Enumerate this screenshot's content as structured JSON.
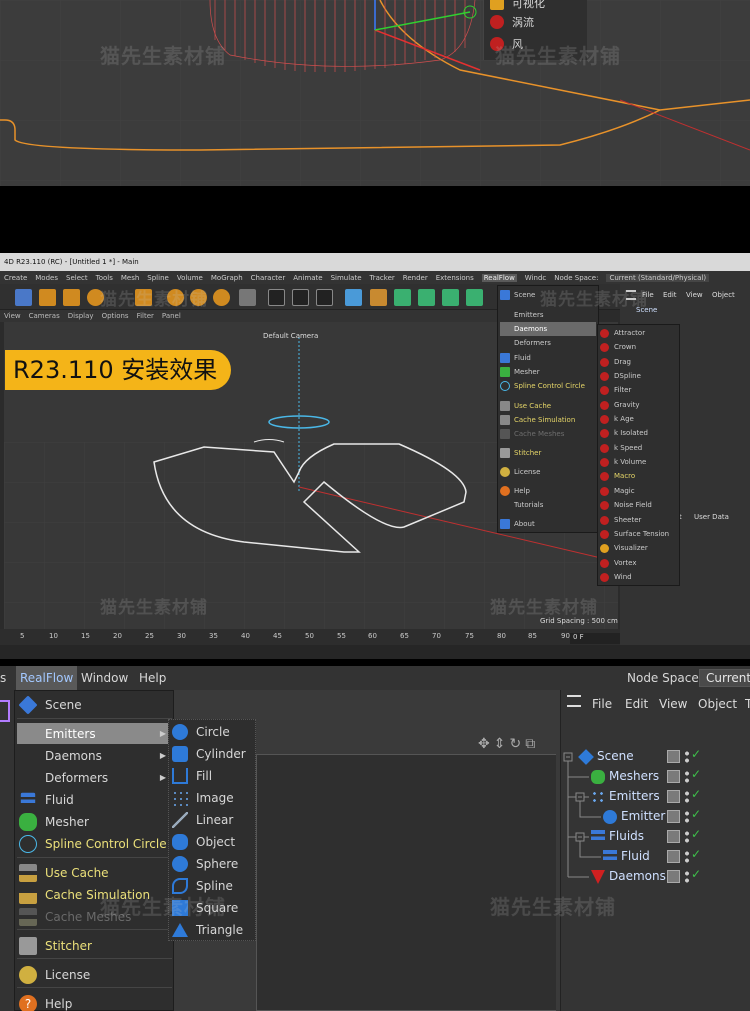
{
  "section1": {
    "menu_items": [
      "可视化",
      "涡流",
      "风"
    ],
    "watermark": "猫先生素材铺"
  },
  "section2": {
    "window_title": "4D R23.110 (RC) - [Untitled 1 *] - Main",
    "menubar": [
      "Create",
      "Modes",
      "Select",
      "Tools",
      "Mesh",
      "Spline",
      "Volume",
      "MoGraph",
      "Character",
      "Animate",
      "Simulate",
      "Tracker",
      "Render",
      "Extensions",
      "RealFlow",
      "Windc",
      "Node Space:",
      "Current (Standard/Physical)"
    ],
    "viewport_menu": [
      "View",
      "Cameras",
      "Display",
      "Options",
      "Filter",
      "Panel"
    ],
    "badge_text": "R23.110 安装效果",
    "camera_label": "Default Camera",
    "realflow_menu": [
      "Scene",
      "Emitters",
      "Daemons",
      "Deformers",
      "Fluid",
      "Mesher",
      "Spline Control Circle",
      "Use Cache",
      "Cache Simulation",
      "Cache Meshes",
      "Stitcher",
      "License",
      "Help",
      "Tutorials",
      "About"
    ],
    "daemons_submenu": [
      "Attractor",
      "Crown",
      "Drag",
      "DSpline",
      "Filter",
      "Gravity",
      "k Age",
      "k Isolated",
      "k Speed",
      "k Volume",
      "Macro",
      "Magic",
      "Noise Field",
      "Sheeter",
      "Surface Tension",
      "Visualizer",
      "Vortex",
      "Wind"
    ],
    "object_panel_tabs": [
      "File",
      "Edit",
      "View",
      "Object"
    ],
    "object_panel_scene": "Scene",
    "attr_tabs": [
      "it",
      "User Data"
    ],
    "grid_spacing": "Grid Spacing : 500 cm",
    "ruler_ticks": [
      "5",
      "10",
      "15",
      "20",
      "25",
      "30",
      "35",
      "40",
      "45",
      "50",
      "55",
      "60",
      "65",
      "70",
      "75",
      "80",
      "85",
      "90"
    ],
    "frame_field": "0 F",
    "watermarks": [
      "猫先生素材铺",
      "猫先生素材铺",
      "猫先生素材铺",
      "猫先生素材铺"
    ]
  },
  "section3": {
    "menubar": [
      "s",
      "RealFlow",
      "Window",
      "Help"
    ],
    "node_space_label": "Node Space:",
    "node_space_value": "Current",
    "realflow_menu": [
      {
        "label": "Scene"
      },
      {
        "label": "Emitters",
        "arrow": "▶"
      },
      {
        "label": "Daemons",
        "arrow": "▶"
      },
      {
        "label": "Deformers",
        "arrow": "▶"
      },
      {
        "label": "Fluid"
      },
      {
        "label": "Mesher"
      },
      {
        "label": "Spline Control Circle"
      },
      {
        "label": "Use Cache"
      },
      {
        "label": "Cache Simulation"
      },
      {
        "label": "Cache Meshes"
      },
      {
        "label": "Stitcher"
      },
      {
        "label": "License"
      },
      {
        "label": "Help"
      }
    ],
    "emitters_submenu": [
      "Circle",
      "Cylinder",
      "Fill",
      "Image",
      "Linear",
      "Object",
      "Sphere",
      "Spline",
      "Square",
      "Triangle"
    ],
    "object_panel_tabs": [
      "File",
      "Edit",
      "View",
      "Object",
      "T"
    ],
    "object_tree": [
      "Scene",
      "Meshers",
      "Emitters",
      "Emitter",
      "Fluids",
      "Fluid",
      "Daemons"
    ],
    "watermarks": [
      "猫先生素材铺",
      "猫先生素材铺"
    ]
  }
}
